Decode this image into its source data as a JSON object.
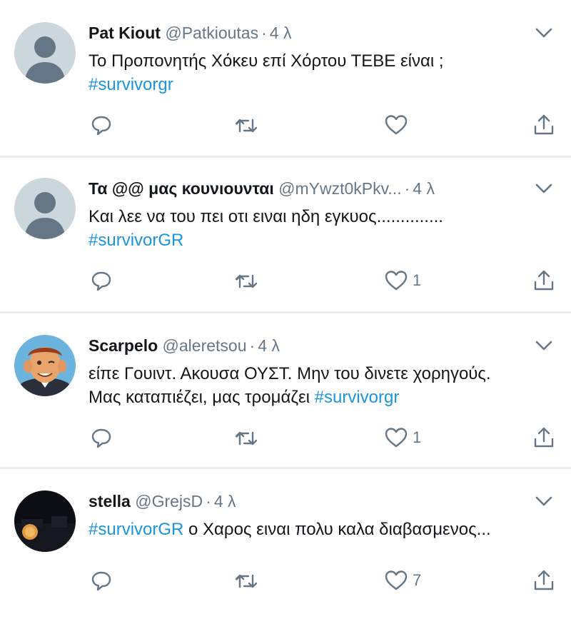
{
  "tweets": [
    {
      "name": "Pat Kiout",
      "handle": "@Patkioutas",
      "time": "4 λ",
      "avatar": "default-avatar-icon",
      "lines": [
        {
          "parts": [
            {
              "text": "Το Προπονητής Χόκευ επί Χόρτου ΤΕΒΕ είναι ;",
              "tag": false
            }
          ]
        },
        {
          "parts": [
            {
              "text": "#survivorgr",
              "tag": true
            }
          ]
        }
      ],
      "reply_count": "",
      "retweet_count": "",
      "like_count": ""
    },
    {
      "name": "Τα @@ μας κουνιουνται",
      "handle": "@mYwzt0kPkv...",
      "time": "4 λ",
      "avatar": "default-avatar-icon",
      "lines": [
        {
          "parts": [
            {
              "text": "Και λεε να του πει οτι ειναι ηδη εγκυος..............",
              "tag": false
            }
          ]
        },
        {
          "parts": [
            {
              "text": "#survivorGR",
              "tag": true
            }
          ]
        }
      ],
      "reply_count": "",
      "retweet_count": "",
      "like_count": "1"
    },
    {
      "name": "Scarpelo",
      "handle": "@aleretsou",
      "time": "4 λ",
      "avatar": "cartoon-face-avatar",
      "lines": [
        {
          "parts": [
            {
              "text": "είπε Γουιντ. Ακουσα ΟΥΣΤ. Μην του δινετε χορηγούς.",
              "tag": false
            }
          ]
        },
        {
          "parts": [
            {
              "text": "Μας καταπιέζει, μας τρομάζει ",
              "tag": false
            },
            {
              "text": "#survivorgr",
              "tag": true
            }
          ]
        }
      ],
      "reply_count": "",
      "retweet_count": "",
      "like_count": "1"
    },
    {
      "name": "stella",
      "handle": "@GrejsD",
      "time": "4 λ",
      "avatar": "night-moon-avatar",
      "lines": [
        {
          "parts": [
            {
              "text": "#survivorGR",
              "tag": true
            },
            {
              "text": " ο Χαρος ειναι πολυ καλα διαβασμενος...",
              "tag": false
            }
          ]
        }
      ],
      "reply_count": "",
      "retweet_count": "",
      "like_count": "7"
    }
  ],
  "colors": {
    "link": "#1b95e0",
    "muted": "#657786",
    "text": "#14171a",
    "divider": "#e6ecf0"
  },
  "icons": {
    "more": "chevron-down-icon",
    "reply": "reply-icon",
    "retweet": "retweet-icon",
    "like": "heart-icon",
    "share": "share-icon"
  }
}
